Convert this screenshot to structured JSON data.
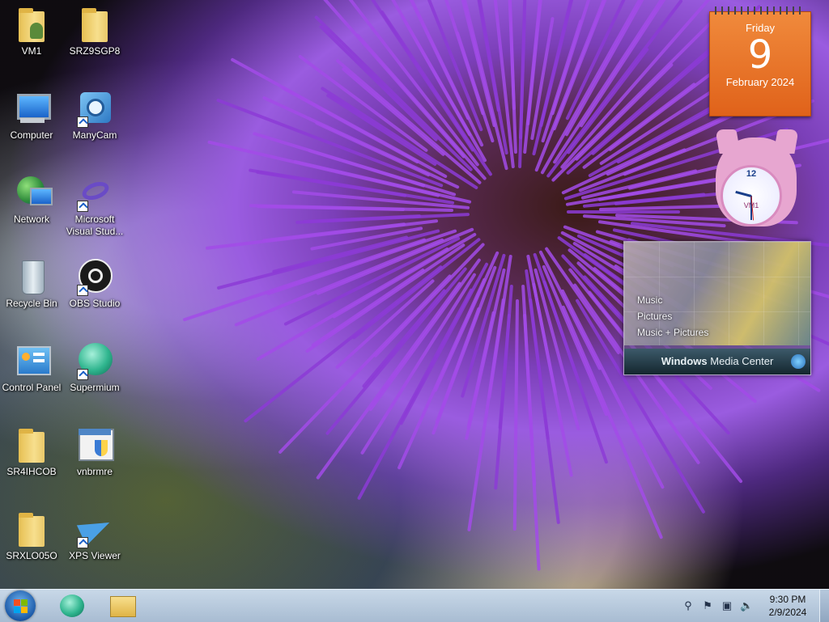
{
  "desktop": {
    "icons": [
      {
        "label": "VM1",
        "icon": "user-folder-icon"
      },
      {
        "label": "SRZ9SGP8",
        "icon": "folder-icon"
      },
      {
        "label": "Computer",
        "icon": "computer-icon"
      },
      {
        "label": "ManyCam",
        "icon": "manycam-icon"
      },
      {
        "label": "Network",
        "icon": "network-icon"
      },
      {
        "label": "Microsoft Visual Stud...",
        "icon": "visual-studio-icon"
      },
      {
        "label": "Recycle Bin",
        "icon": "recycle-bin-icon"
      },
      {
        "label": "OBS Studio",
        "icon": "obs-studio-icon"
      },
      {
        "label": "Control Panel",
        "icon": "control-panel-icon"
      },
      {
        "label": "Supermium",
        "icon": "supermium-icon"
      },
      {
        "label": "SR4IHCOB",
        "icon": "folder-icon"
      },
      {
        "label": "vnbrmre",
        "icon": "installer-icon"
      },
      {
        "label": "SRXLO05O",
        "icon": "folder-icon"
      },
      {
        "label": "XPS Viewer",
        "icon": "xps-viewer-icon"
      }
    ]
  },
  "gadgets": {
    "calendar": {
      "day": "Friday",
      "date": "9",
      "month": "February 2024"
    },
    "clock": {
      "label": "VM1",
      "numeral": "12"
    },
    "media_center": {
      "items": [
        "Music",
        "Pictures",
        "Music + Pictures"
      ],
      "brand_bold": "Windows",
      "brand_rest": " Media Center"
    }
  },
  "taskbar": {
    "time": "9:30 PM",
    "date": "2/9/2024",
    "pinned": [
      "supermium-icon",
      "file-explorer-icon"
    ],
    "tray": [
      "search-icon",
      "action-center-flag-icon",
      "network-icon",
      "volume-icon"
    ]
  },
  "colors": {
    "calendar_orange": "#e8701f",
    "accent_purple": "#9b4de0",
    "taskbar": "#b9cbe0"
  }
}
